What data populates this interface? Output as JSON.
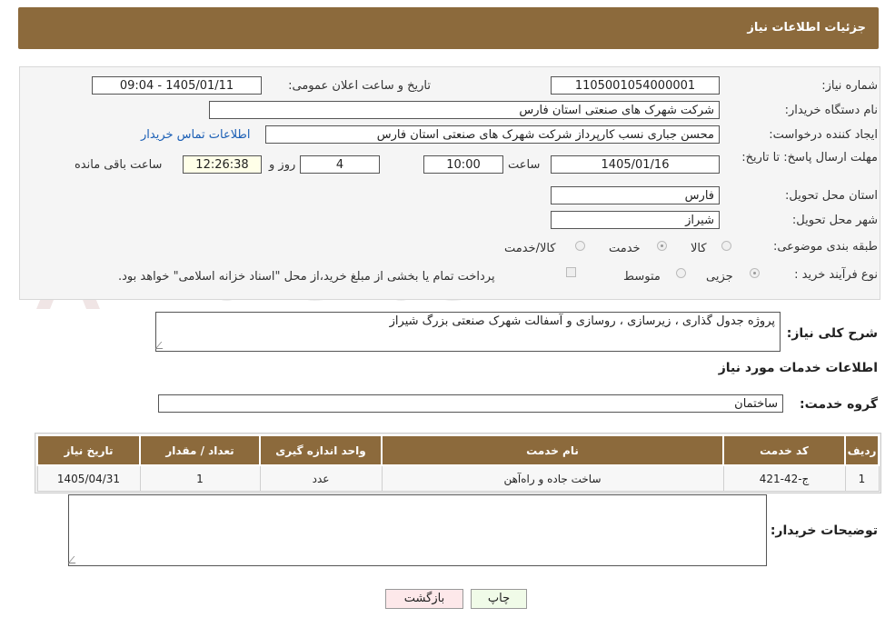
{
  "header": {
    "title": "جزئیات اطلاعات نیاز"
  },
  "form": {
    "need_number_label": "شماره نیاز:",
    "need_number": "1105001054000001",
    "announce_label": "تاریخ و ساعت اعلان عمومی:",
    "announce_value": "1405/01/11 - 09:04",
    "buyer_label": "نام دستگاه خریدار:",
    "buyer_value": "شرکت شهرک های صنعتی استان فارس",
    "creator_label": "ایجاد کننده درخواست:",
    "creator_value": "محسن  جباری نسب کارپرداز شرکت شهرک های صنعتی استان فارس",
    "contact_link": "اطلاعات تماس خریدار",
    "deadline_label": "مهلت ارسال پاسخ: تا تاریخ:",
    "deadline_date": "1405/01/16",
    "time_label": "ساعت",
    "deadline_time": "10:00",
    "days_value": "4",
    "days_label": "روز و",
    "remaining_time": "12:26:38",
    "remaining_label": "ساعت باقی مانده",
    "province_label": "استان محل تحویل:",
    "province_value": "فارس",
    "city_label": "شهر محل تحویل:",
    "city_value": "شیراز",
    "category_label": "طبقه بندی موضوعی:",
    "category_options": [
      "کالا",
      "خدمت",
      "کالا/خدمت"
    ],
    "category_selected": "خدمت",
    "process_label": "نوع فرآیند خرید :",
    "process_options": [
      "جزیی",
      "متوسط"
    ],
    "process_selected": "جزیی",
    "payment_note": "پرداخت تمام یا بخشی از مبلغ خرید،از محل \"اسناد خزانه اسلامی\" خواهد بود."
  },
  "summary": {
    "label": "شرح کلی نیاز:",
    "value": "پروژه جدول گذاری ، زیرسازی ، روسازی و آسفالت شهرک صنعتی بزرگ شیراز"
  },
  "services": {
    "section_title": "اطلاعات خدمات مورد نیاز",
    "group_label": "گروه خدمت:",
    "group_value": "ساختمان",
    "columns": [
      "ردیف",
      "کد خدمت",
      "نام خدمت",
      "واحد اندازه گیری",
      "تعداد / مقدار",
      "تاریخ نیاز"
    ],
    "rows": [
      [
        "1",
        "ج-42-421",
        "ساخت جاده و راه‌آهن",
        "عدد",
        "1",
        "1405/04/31"
      ]
    ]
  },
  "buyer_notes": {
    "label": "توضیحات خریدار:",
    "value": ""
  },
  "buttons": {
    "print": "چاپ",
    "back": "بازگشت"
  },
  "watermark": {
    "text": "AriaTender.neT"
  },
  "colors": {
    "header": "#8c6a3c",
    "link": "#1b5fb5",
    "print_btn": "#f0fbe8",
    "back_btn": "#fde8ea"
  }
}
